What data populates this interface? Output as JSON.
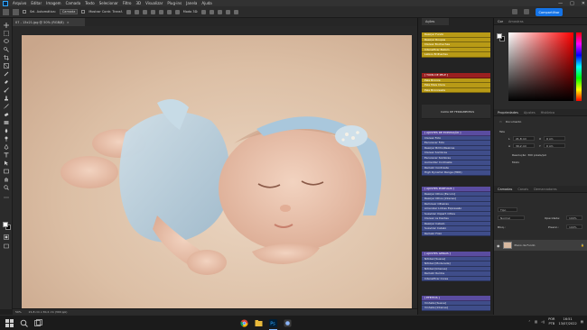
{
  "menubar": {
    "items": [
      "Arquivo",
      "Editar",
      "Imagem",
      "Camada",
      "Texto",
      "Selecionar",
      "Filtro",
      "3D",
      "Visualizar",
      "Plug-ins",
      "Janela",
      "Ajuda"
    ],
    "window_controls": [
      "—",
      "□",
      "✕"
    ]
  },
  "options": {
    "auto_select_label": "Sel. Automática:",
    "auto_select_value": "Camada",
    "show_transform_label": "Mostrar Contr. Transf.",
    "mode_3d_label": "Modo 3D:",
    "share_label": "Compartilhar"
  },
  "document": {
    "tab_title": "07 - 13x21.jpg @ 50% (RGB/8)",
    "tab_close": "×",
    "zoom": "50%",
    "doc_info": "21,8 cm x 30,2 cm (300 ppi)"
  },
  "actions": {
    "tab_label": "Ações",
    "gold_top": [
      "Realçar Fundo",
      "Realçar Roupas",
      "Clarear Bochechas",
      "Intensificar Batom",
      "Labios Brilhantes"
    ],
    "skin_header": "[ TONS DE PELE ]",
    "skin_items": [
      "Pele Bronze",
      "Pele Mais Clara",
      "Pele Bronzeada"
    ],
    "toolbox": "CAIXA DE FERRAMENTAS",
    "exposure_header": "[ AJUSTES DE EXPOSIÇÃO ]",
    "exposure_items": [
      "Clarear Foto",
      "Escurecer Foto",
      "Realçar Brilho/Realces",
      "Clarear Sombras",
      "Escurecer Sombras",
      "Aumentar Contraste",
      "Reduzir Contraste",
      "High Dynamic Range (HDR)"
    ],
    "portrait_header": "[ AJUSTES PORTUAIS ]",
    "portrait_items": [
      "Realçar Olhos [Escuro]",
      "Realçar Olhos [Intenso]",
      "Remover Olheiras",
      "Amenizar Linhas Expressão",
      "Suavizar Imperf. Olhos",
      "Clarear os Dentes",
      "Realçar Cabelo",
      "Suavizar Cabelo",
      "Reduzir Frizz"
    ],
    "general_header": "[ AJUSTES GERAIS ]",
    "general_items": [
      "Nitidez [Suave]",
      "Nitidez [Moderada]",
      "Nitidez [Intensa]",
      "Reduzir Ruídos",
      "Intensificar Cores"
    ],
    "effects_header": "[ EFEITOS ]",
    "effects_items": [
      "Vinheta [Suave]",
      "Vinheta [Intensa]"
    ]
  },
  "color_panel": {
    "tabs": [
      "Cor",
      "Amostras"
    ]
  },
  "properties": {
    "tabs": [
      "Propriedades",
      "Ajustes",
      "Histórico"
    ],
    "doc_label": "Documento",
    "size_label": "Tela",
    "width_label": "L",
    "width_value": "21,8 cm",
    "height_label": "A",
    "height_value": "30,2 cm",
    "x_label": "X",
    "x_value": "0 cm",
    "y_label": "Y",
    "y_value": "0 cm",
    "resolution": "Resolução: 300 pixels/pol",
    "mode_label": "Modo"
  },
  "layers": {
    "tabs": [
      "Camadas",
      "Canais",
      "Demarcadores"
    ],
    "kind_label": "Tipo",
    "blend_mode": "Normal",
    "opacity_label": "Opacidade:",
    "opacity_value": "100%",
    "lock_label": "Bloq.:",
    "fill_label": "Preenc.:",
    "fill_value": "100%",
    "layer_name": "Plano de Fundo",
    "layer_lock": "🔒"
  },
  "taskbar": {
    "lang_top": "POR",
    "lang_bottom": "PTB",
    "time": "16:51",
    "date": "13/07/2022"
  }
}
